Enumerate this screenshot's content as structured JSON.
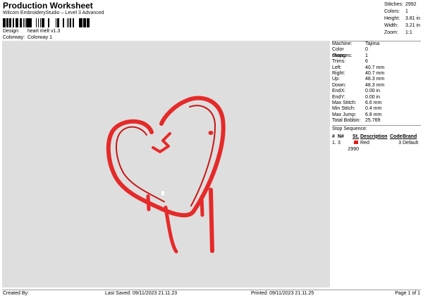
{
  "header": {
    "title": "Production Worksheet",
    "subtitle": "Wilcom EmbroideryStudio – Level 3 Advanced",
    "design_label": "Design:",
    "design_value": "heart melt v1.3",
    "colorway_label": "Colorway:",
    "colorway_value": "Colorway 1"
  },
  "stats": [
    {
      "label": "Stitches:",
      "value": "2992"
    },
    {
      "label": "Colors:",
      "value": "1"
    },
    {
      "label": "Height:",
      "value": "3.81 in"
    },
    {
      "label": "Width:",
      "value": "3.21 in"
    },
    {
      "label": "Zoom:",
      "value": "1:1"
    }
  ],
  "machine": [
    {
      "label": "Machine:",
      "value": "Tajima"
    },
    {
      "label": "Color changes:",
      "value": "0"
    },
    {
      "label": "Stops:",
      "value": "1"
    },
    {
      "label": "Trims:",
      "value": "6"
    },
    {
      "label": "Left:",
      "value": "40.7 mm"
    },
    {
      "label": "Right:",
      "value": "40.7 mm"
    },
    {
      "label": "Up:",
      "value": "48.3 mm"
    },
    {
      "label": "Down:",
      "value": "48.3 mm"
    },
    {
      "label": "EndX:",
      "value": "0.00 in"
    },
    {
      "label": "EndY:",
      "value": "0.00 in"
    },
    {
      "label": "Max Stitch:",
      "value": "6.6 mm"
    },
    {
      "label": "Min Stitch:",
      "value": "0.4 mm"
    },
    {
      "label": "Max Jump:",
      "value": "6.8 mm"
    },
    {
      "label": "Total Bobbin:",
      "value": "25.76ft"
    }
  ],
  "stop_sequence": {
    "label": "Stop Sequence:",
    "headers": {
      "idx": "#",
      "n": "N#",
      "st": "St.",
      "desc": "Description",
      "code": "Code",
      "name": "Brand"
    },
    "rows": [
      {
        "idx": "1.",
        "n": "3",
        "color": "#e31b1b",
        "st": "2990",
        "desc": "Red",
        "code": "3",
        "name": "Default"
      }
    ]
  },
  "design_colors": {
    "stitch": "#e52a2a",
    "stitch_dark": "#c91616",
    "background": "#dedede"
  },
  "footer": {
    "created": "Created By:",
    "saved": "Last Saved: 09/11/2023 21.11.23",
    "printed": "Printed: 09/11/2023 21.11.25",
    "page": "Page 1 of 1"
  }
}
